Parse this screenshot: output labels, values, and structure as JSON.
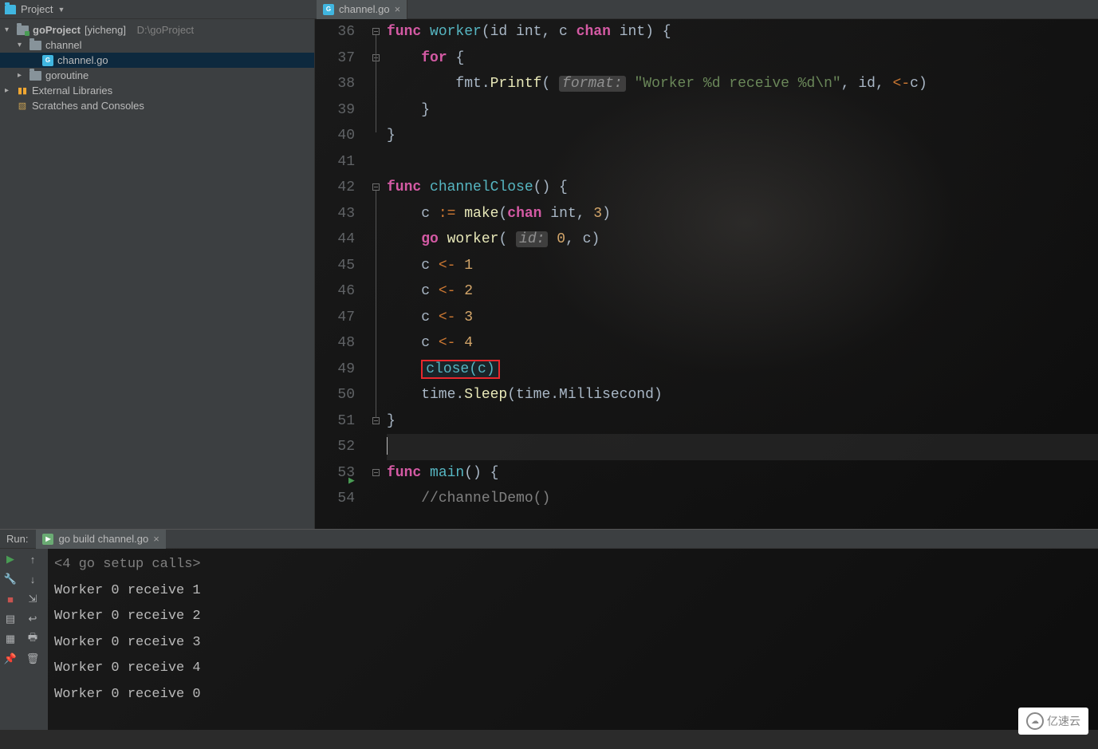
{
  "toolbar": {
    "project_label": "Project"
  },
  "tree": {
    "root": {
      "label": "goProject",
      "qualifier": "[yicheng]",
      "path": "D:\\goProject"
    },
    "channel": "channel",
    "channel_file": "channel.go",
    "goroutine": "goroutine",
    "ext_lib": "External Libraries",
    "scratches": "Scratches and Consoles"
  },
  "tab": {
    "label": "channel.go"
  },
  "code": {
    "lines": [
      {
        "n": "36",
        "seg": [
          {
            "t": "func ",
            "c": "kw2"
          },
          {
            "t": "worker",
            "c": "fn"
          },
          {
            "t": "(id ",
            "c": "typ"
          },
          {
            "t": "int",
            "c": "typ"
          },
          {
            "t": ", c ",
            "c": "typ"
          },
          {
            "t": "chan ",
            "c": "kw2"
          },
          {
            "t": "int",
            "c": "typ"
          },
          {
            "t": ") {",
            "c": "typ"
          }
        ]
      },
      {
        "n": "37",
        "seg": [
          {
            "t": "    ",
            "c": ""
          },
          {
            "t": "for ",
            "c": "kw2"
          },
          {
            "t": "{",
            "c": "typ"
          }
        ]
      },
      {
        "n": "38",
        "seg": [
          {
            "t": "        fmt.",
            "c": "typ"
          },
          {
            "t": "Printf",
            "c": "fcall"
          },
          {
            "t": "( ",
            "c": "typ"
          },
          {
            "t": "format:",
            "c": "param-hint"
          },
          {
            "t": " ",
            "c": ""
          },
          {
            "t": "\"Worker %d receive %d\\n\"",
            "c": "str"
          },
          {
            "t": ", id, ",
            "c": "typ"
          },
          {
            "t": "<-",
            "c": "op"
          },
          {
            "t": "c)",
            "c": "typ"
          }
        ]
      },
      {
        "n": "39",
        "seg": [
          {
            "t": "    }",
            "c": "typ"
          }
        ]
      },
      {
        "n": "40",
        "seg": [
          {
            "t": "}",
            "c": "typ"
          }
        ]
      },
      {
        "n": "41",
        "seg": [
          {
            "t": "",
            "c": ""
          }
        ]
      },
      {
        "n": "42",
        "seg": [
          {
            "t": "func ",
            "c": "kw2"
          },
          {
            "t": "channelClose",
            "c": "fn"
          },
          {
            "t": "() {",
            "c": "typ"
          }
        ]
      },
      {
        "n": "43",
        "seg": [
          {
            "t": "    c ",
            "c": "typ"
          },
          {
            "t": ":=",
            "c": "op"
          },
          {
            "t": " ",
            "c": ""
          },
          {
            "t": "make",
            "c": "fcall"
          },
          {
            "t": "(",
            "c": "typ"
          },
          {
            "t": "chan ",
            "c": "kw2"
          },
          {
            "t": "int",
            "c": "typ"
          },
          {
            "t": ", ",
            "c": "typ"
          },
          {
            "t": "3",
            "c": "num"
          },
          {
            "t": ")",
            "c": "typ"
          }
        ]
      },
      {
        "n": "44",
        "seg": [
          {
            "t": "    ",
            "c": ""
          },
          {
            "t": "go ",
            "c": "kw2"
          },
          {
            "t": "worker",
            "c": "fcall"
          },
          {
            "t": "( ",
            "c": "typ"
          },
          {
            "t": "id:",
            "c": "param-hint"
          },
          {
            "t": " ",
            "c": ""
          },
          {
            "t": "0",
            "c": "num"
          },
          {
            "t": ", c)",
            "c": "typ"
          }
        ]
      },
      {
        "n": "45",
        "seg": [
          {
            "t": "    c ",
            "c": "typ"
          },
          {
            "t": "<- ",
            "c": "op"
          },
          {
            "t": "1",
            "c": "num"
          }
        ]
      },
      {
        "n": "46",
        "seg": [
          {
            "t": "    c ",
            "c": "typ"
          },
          {
            "t": "<- ",
            "c": "op"
          },
          {
            "t": "2",
            "c": "num"
          }
        ]
      },
      {
        "n": "47",
        "seg": [
          {
            "t": "    c ",
            "c": "typ"
          },
          {
            "t": "<- ",
            "c": "op"
          },
          {
            "t": "3",
            "c": "num"
          }
        ]
      },
      {
        "n": "48",
        "seg": [
          {
            "t": "    c ",
            "c": "typ"
          },
          {
            "t": "<- ",
            "c": "op"
          },
          {
            "t": "4",
            "c": "num"
          }
        ]
      },
      {
        "n": "49",
        "seg": [
          {
            "t": "    ",
            "c": ""
          },
          {
            "t": "close(c)",
            "c": "fn",
            "box": true
          }
        ]
      },
      {
        "n": "50",
        "seg": [
          {
            "t": "    time.",
            "c": "typ"
          },
          {
            "t": "Sleep",
            "c": "fcall"
          },
          {
            "t": "(time.Millisecond)",
            "c": "typ"
          }
        ]
      },
      {
        "n": "51",
        "seg": [
          {
            "t": "}",
            "c": "typ"
          }
        ]
      },
      {
        "n": "52",
        "seg": [
          {
            "t": "",
            "c": ""
          }
        ],
        "current": true,
        "caret": true
      },
      {
        "n": "53",
        "seg": [
          {
            "t": "func ",
            "c": "kw2"
          },
          {
            "t": "main",
            "c": "fn"
          },
          {
            "t": "() {",
            "c": "typ"
          }
        ],
        "run": true
      },
      {
        "n": "54",
        "seg": [
          {
            "t": "    ",
            "c": ""
          },
          {
            "t": "//channelDemo()",
            "c": "cmt"
          }
        ]
      }
    ],
    "fold_marks": [
      0,
      1,
      6,
      15,
      17
    ],
    "fold_lines": [
      {
        "from": 0,
        "to": 4
      },
      {
        "from": 6,
        "to": 15
      }
    ]
  },
  "run": {
    "label": "Run:",
    "tab": "go build channel.go",
    "output": [
      "<4 go setup calls>",
      "Worker 0 receive 1",
      "Worker 0 receive 2",
      "Worker 0 receive 3",
      "Worker 0 receive 4",
      "Worker 0 receive 0"
    ]
  },
  "watermark": "亿速云"
}
